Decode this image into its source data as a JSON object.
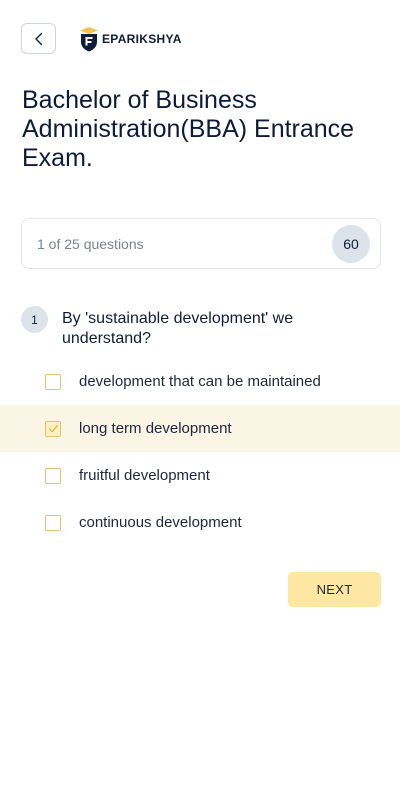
{
  "header": {
    "back_icon": "chevron-left-icon",
    "logo_text": "EPARIKSHYA",
    "logo_icon": "graduation-shield-logo",
    "brand_color": "#0f1c3a",
    "accent_color": "#f2c14e"
  },
  "exam": {
    "title": "Bachelor of Business Administration(BBA) Entrance Exam."
  },
  "progress": {
    "text": "1 of 25 questions",
    "current": 1,
    "total": 25,
    "timer": "60"
  },
  "question": {
    "number": "1",
    "text": "By 'sustainable development' we understand?",
    "options": [
      {
        "label": "development that can be maintained",
        "checked": false
      },
      {
        "label": "long term development",
        "checked": true
      },
      {
        "label": "fruitful development",
        "checked": false
      },
      {
        "label": "continuous development",
        "checked": false
      }
    ]
  },
  "actions": {
    "next_label": "NEXT"
  }
}
